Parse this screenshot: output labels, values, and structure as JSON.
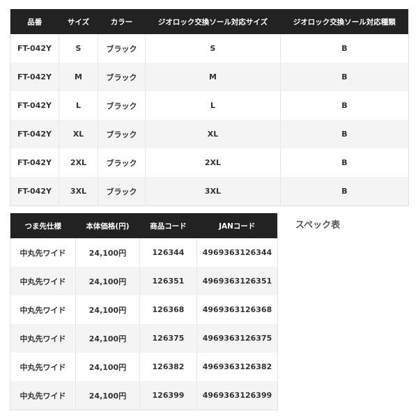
{
  "table1": {
    "headers": [
      "品番",
      "サイズ",
      "カラー",
      "ジオロック交換ソール対応サイズ",
      "ジオロック交換ソール対応種類"
    ],
    "rows": [
      [
        "FT-042Y",
        "S",
        "ブラック",
        "S",
        "B"
      ],
      [
        "FT-042Y",
        "M",
        "ブラック",
        "M",
        "B"
      ],
      [
        "FT-042Y",
        "L",
        "ブラック",
        "L",
        "B"
      ],
      [
        "FT-042Y",
        "XL",
        "ブラック",
        "XL",
        "B"
      ],
      [
        "FT-042Y",
        "2XL",
        "ブラック",
        "2XL",
        "B"
      ],
      [
        "FT-042Y",
        "3XL",
        "ブラック",
        "3XL",
        "B"
      ]
    ]
  },
  "table2": {
    "headers": [
      "つま先仕様",
      "本体価格(円)",
      "商品コード",
      "JANコード"
    ],
    "rows": [
      [
        "中丸先ワイド",
        "24,100円",
        "126344",
        "4969363126344"
      ],
      [
        "中丸先ワイド",
        "24,100円",
        "126351",
        "4969363126351"
      ],
      [
        "中丸先ワイド",
        "24,100円",
        "126368",
        "4969363126368"
      ],
      [
        "中丸先ワイド",
        "24,100円",
        "126375",
        "4969363126375"
      ],
      [
        "中丸先ワイド",
        "24,100円",
        "126382",
        "4969363126382"
      ],
      [
        "中丸先ワイド",
        "24,100円",
        "126399",
        "4969363126399"
      ]
    ]
  },
  "caption": "スペック表"
}
